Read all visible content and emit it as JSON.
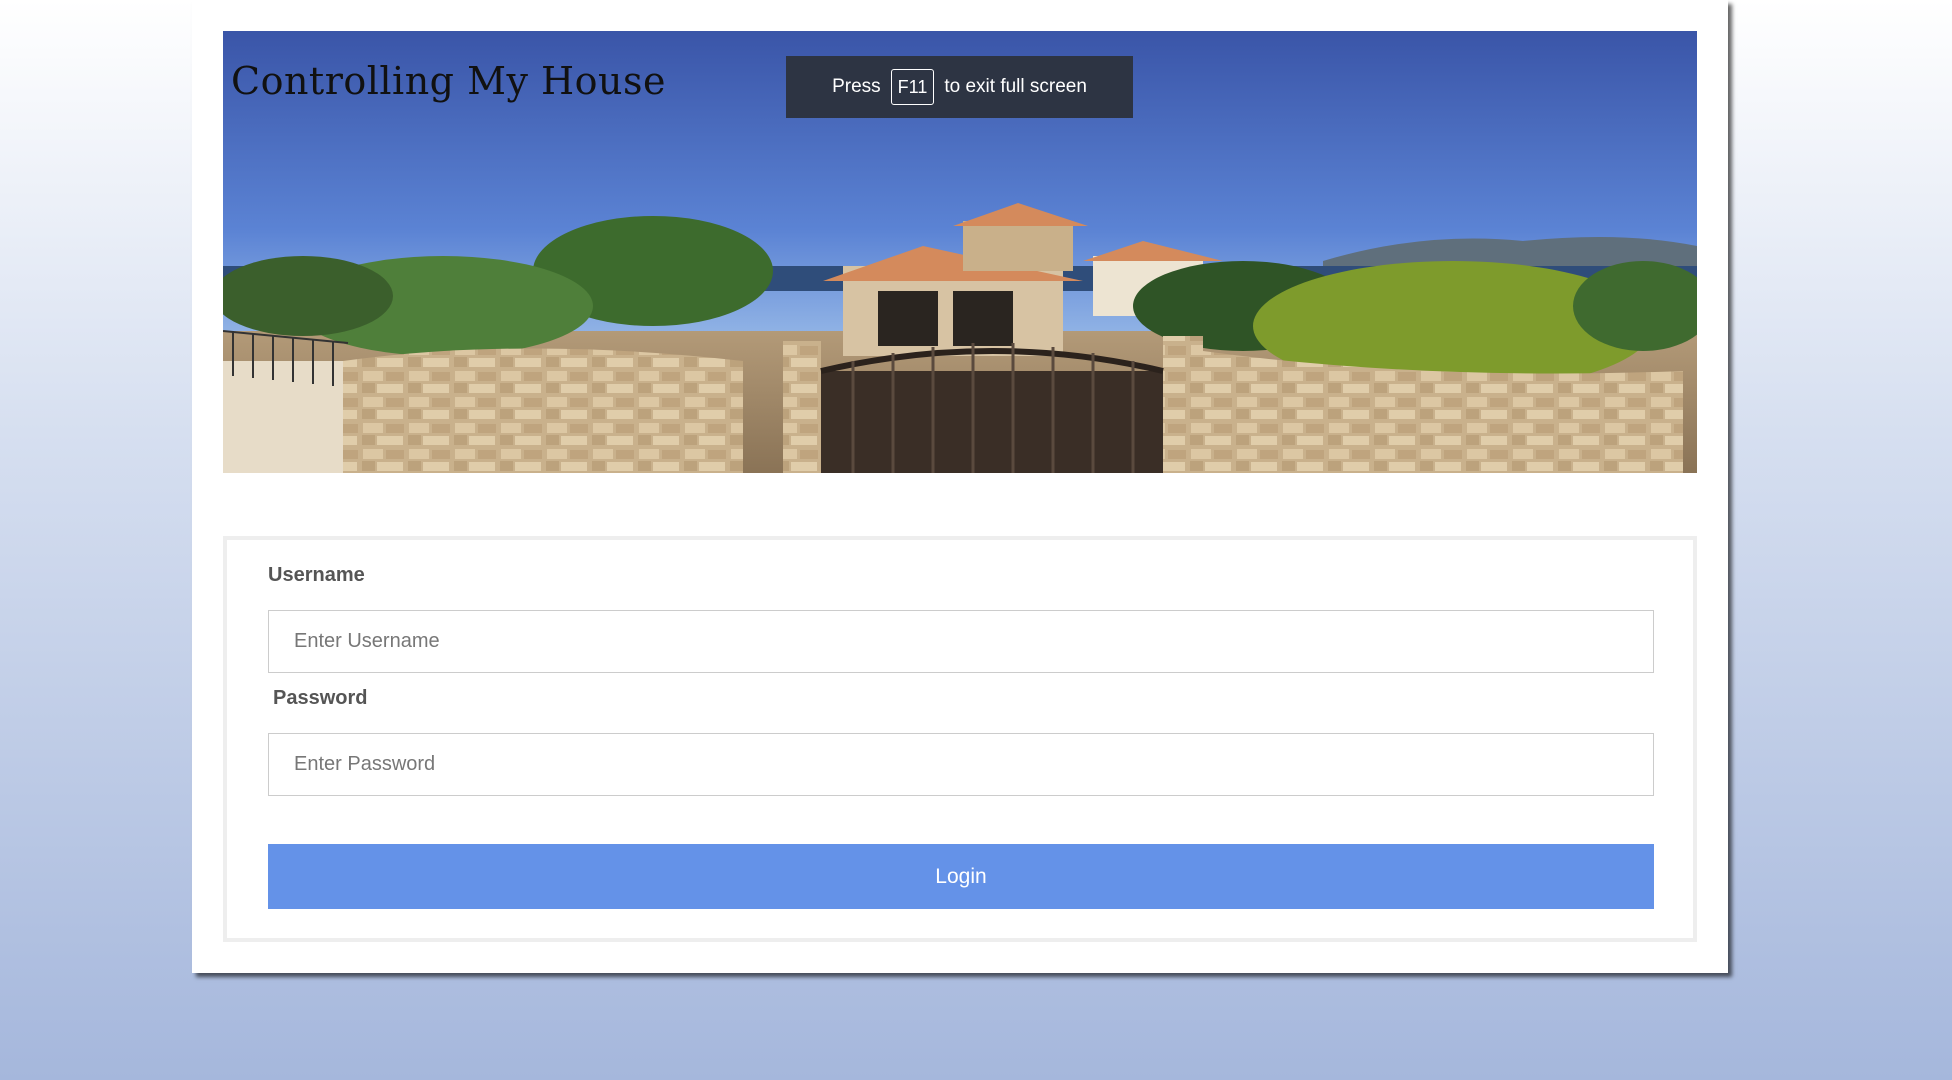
{
  "header": {
    "title": "Controlling My House"
  },
  "fullscreen_notice": {
    "prefix": "Press",
    "key": "F11",
    "suffix": "to exit full screen"
  },
  "banner": {
    "image": "house-panorama-image"
  },
  "login_form": {
    "username_label": "Username",
    "username_placeholder": "Enter Username",
    "username_value": "",
    "password_label": "Password",
    "password_placeholder": "Enter Password",
    "password_value": "",
    "login_label": "Login"
  },
  "colors": {
    "login_button": "#6492e8",
    "toast_background": "#2d3443"
  }
}
